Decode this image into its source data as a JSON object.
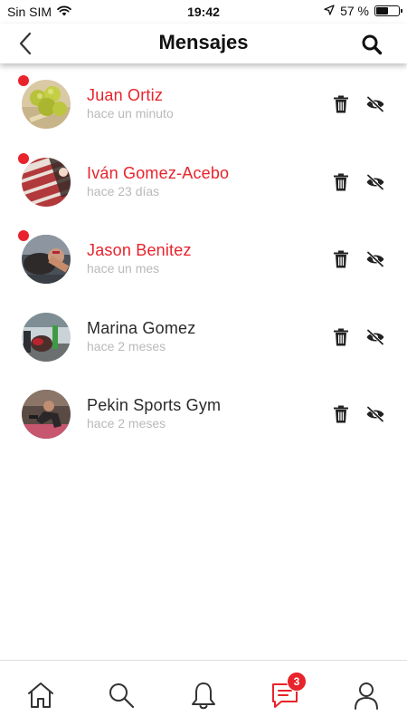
{
  "status_bar": {
    "carrier": "Sin SIM",
    "time": "19:42",
    "battery_text": "57 %",
    "battery_level": 0.57
  },
  "header": {
    "title": "Mensajes"
  },
  "conversations": [
    {
      "name": "Juan Ortiz",
      "time": "hace un minuto",
      "unread": true
    },
    {
      "name": "Iván Gomez-Acebo",
      "time": "hace 23 días",
      "unread": true
    },
    {
      "name": "Jason Benitez",
      "time": "hace un mes",
      "unread": true
    },
    {
      "name": "Marina Gomez",
      "time": "hace 2 meses",
      "unread": false
    },
    {
      "name": "Pekin Sports Gym",
      "time": "hace 2 meses",
      "unread": false
    }
  ],
  "tabbar": {
    "messages_badge": "3",
    "items": [
      "home-icon",
      "search-icon",
      "bell-icon",
      "chat-icon",
      "user-icon"
    ]
  },
  "colors": {
    "accent": "#e8232b",
    "muted": "#b9b9b9"
  }
}
